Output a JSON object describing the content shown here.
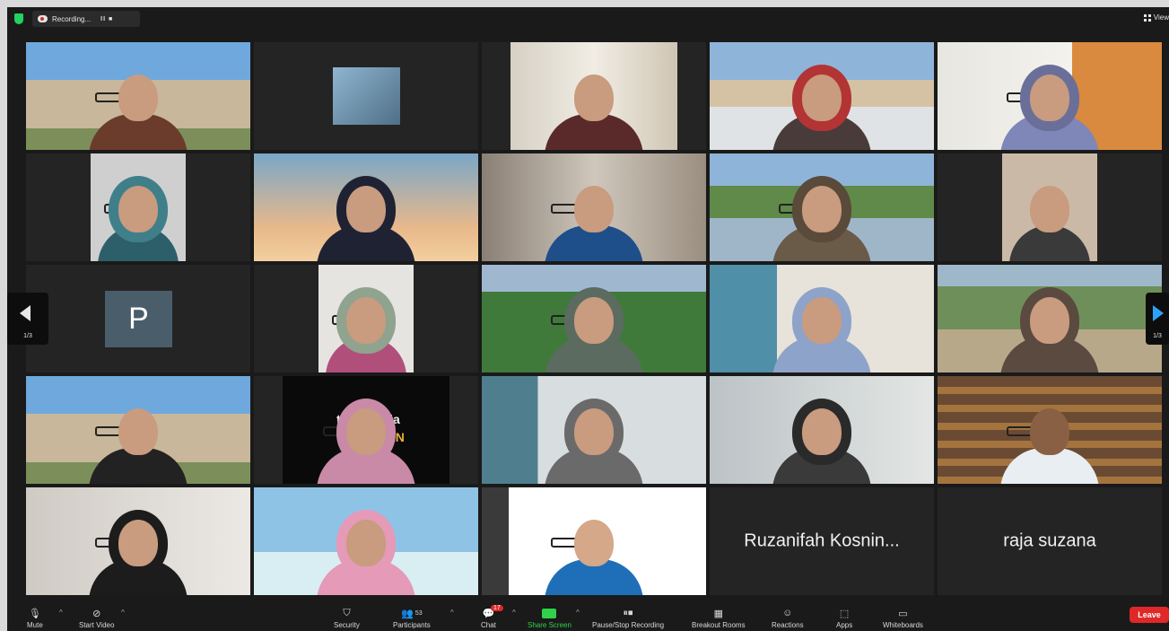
{
  "topbar": {
    "recording_label": "Recording...",
    "recording_controls": "II ■",
    "view_label": "View"
  },
  "nav": {
    "page_left": "1/3",
    "page_right": "1/3"
  },
  "tiles": {
    "t20": "Ruzanifah Kosnin...",
    "t21": "raja suzana",
    "avatar_letter": "P",
    "banner_line1": "ti Malaysia",
    "banner_line2": "NTAN"
  },
  "toolbar": {
    "mute": "Mute",
    "start_video": "Start Video",
    "security": "Security",
    "participants": "Participants",
    "participants_count": "53",
    "chat": "Chat",
    "chat_badge": "17",
    "share_screen": "Share Screen",
    "pause_stop_recording": "Pause/Stop Recording",
    "breakout_rooms": "Breakout Rooms",
    "reactions": "Reactions",
    "apps": "Apps",
    "whiteboards": "Whiteboards",
    "leave": "Leave"
  },
  "colors": {
    "active_speaker": "#2fd24a",
    "leave": "#e02828",
    "share": "#2fd24a",
    "nav_arrow_right": "#2ea1ff"
  }
}
